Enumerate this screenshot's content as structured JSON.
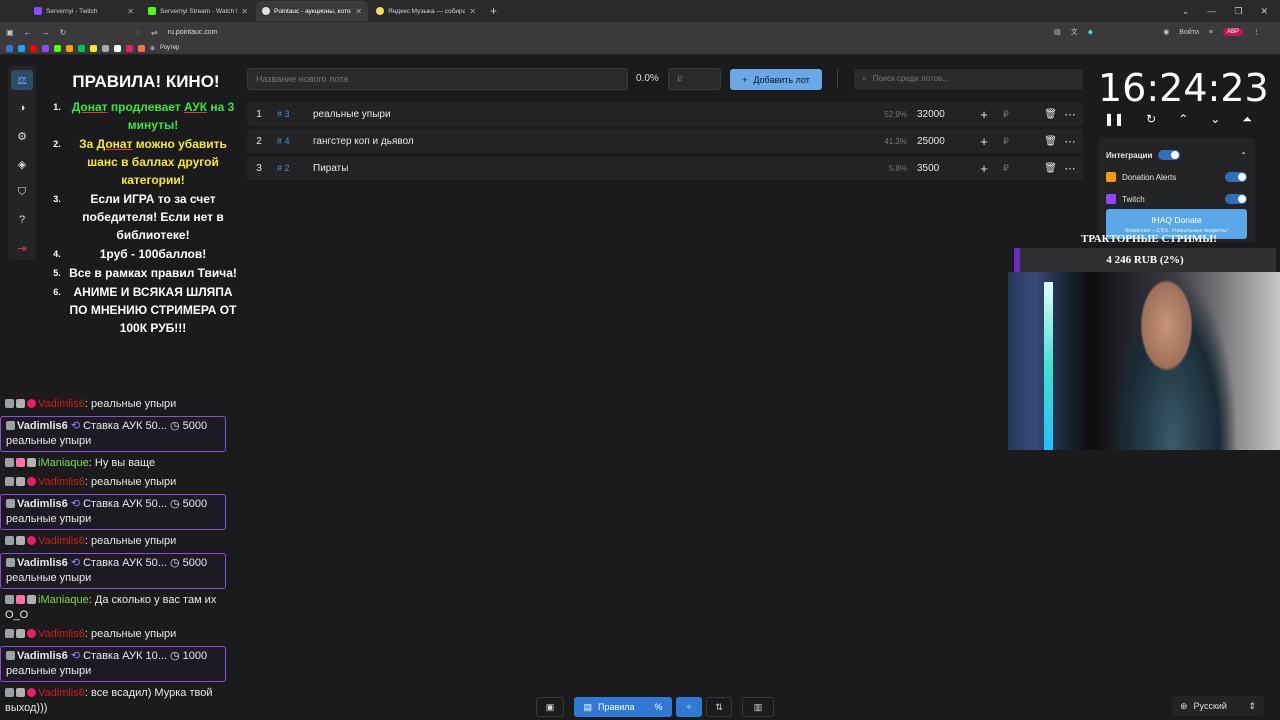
{
  "browser": {
    "tabs": [
      {
        "title": "Servernyi - Twitch",
        "color": "#9146ff"
      },
      {
        "title": "Servernyi Stream - Watch Live",
        "color": "#53fc18"
      },
      {
        "title": "Pointauc - аукционы, котор",
        "color": "#e0e0e0"
      },
      {
        "title": "Яндекс Музыка — собира",
        "color": "#ffdb4d"
      }
    ],
    "url": "ru.pointauc.com",
    "login_label": "Войти",
    "bookmark_label": "Роутер"
  },
  "rules": {
    "title": "ПРАВИЛА! КИНО!",
    "items": [
      {
        "n": "1.",
        "a": "Донат",
        "b": " продлевает ",
        "c": "АУК",
        "d": " на 3 минуты!"
      },
      {
        "n": "2.",
        "a": "За ",
        "b": "Донат",
        "c": " можно убавить шанс в баллах другой категории!"
      },
      {
        "n": "3.",
        "text": "Если ИГРА то за счет победителя! Если нет в библиотеке!"
      },
      {
        "n": "4.",
        "text": "1руб - 100баллов!"
      },
      {
        "n": "5.",
        "text": "Все в рамках правил Твича!"
      },
      {
        "n": "6.",
        "text": "АНИМЕ И ВСЯКАЯ ШЛЯПА ПО МНЕНИЮ СТРИМЕРА ОТ 100К РУБ!!!"
      }
    ]
  },
  "chat": [
    {
      "type": "msg",
      "user": "Vadimlis6",
      "user_color": "red",
      "text": "реальные упыри"
    },
    {
      "type": "donate",
      "user": "Vadimlis6",
      "desc": "Ставка АУК 50...",
      "amount": "5000",
      "text": "реальные упыри"
    },
    {
      "type": "msg",
      "user": "iManiaque",
      "user_color": "lime",
      "text": "Ну вы ваще"
    },
    {
      "type": "msg",
      "user": "Vadimlis6",
      "user_color": "red",
      "text": "реальные упыри"
    },
    {
      "type": "donate",
      "user": "Vadimlis6",
      "desc": "Ставка АУК 50...",
      "amount": "5000",
      "text": "реальные упыри"
    },
    {
      "type": "msg",
      "user": "Vadimlis6",
      "user_color": "red",
      "text": "реальные упыри"
    },
    {
      "type": "donate",
      "user": "Vadimlis6",
      "desc": "Ставка АУК 50...",
      "amount": "5000",
      "text": "реальные упыри"
    },
    {
      "type": "msg",
      "user": "iManiaque",
      "user_color": "lime",
      "text": "Да сколько у вас там их О_О"
    },
    {
      "type": "msg",
      "user": "Vadimlis6",
      "user_color": "red",
      "text": "реальные упыри"
    },
    {
      "type": "donate",
      "user": "Vadimlis6",
      "desc": "Ставка АУК 10...",
      "amount": "1000",
      "text": "реальные упыри"
    },
    {
      "type": "msg",
      "user": "Vadimlis6",
      "user_color": "red",
      "text": "все всадил) Мурка твой выход)))"
    }
  ],
  "controls": {
    "new_lot_placeholder": "Название нового лота",
    "percent": "0.0%",
    "currency_placeholder": "₽",
    "add_lot": "Добавить лот",
    "search_placeholder": "Поиск среди лотов..."
  },
  "lots": [
    {
      "num": "1",
      "id": "# 3",
      "name": "реальные упыри",
      "pct": "52.9%",
      "amount": "32000"
    },
    {
      "num": "2",
      "id": "# 4",
      "name": "гангстер коп и дьявол",
      "pct": "41.3%",
      "amount": "25000"
    },
    {
      "num": "3",
      "id": "# 2",
      "name": "Пираты",
      "pct": "5.8%",
      "amount": "3500"
    }
  ],
  "timer": "16:24:23",
  "integrations": {
    "title": "Интеграции",
    "items": [
      "Donation Alerts",
      "Twitch"
    ],
    "button": "IHAQ Donate",
    "button_note": "Комиссия – 3,5%. Уникальные виджеты!"
  },
  "overlay": {
    "title": "ТРАКТОРНЫЕ СТРИМЫ!",
    "goal_text": "4 246 RUB (2%)",
    "goal_fraction": 0.02
  },
  "bottom": {
    "rules_label": "Правила"
  },
  "language": "Русский"
}
